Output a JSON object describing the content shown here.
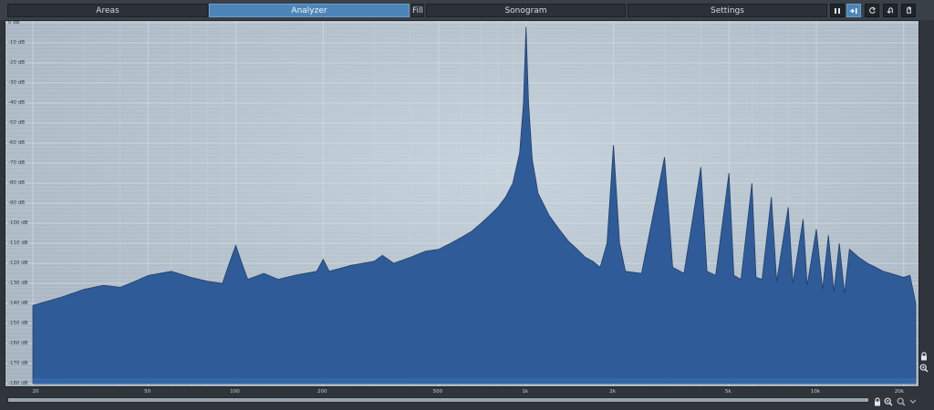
{
  "toolbar": {
    "tabs": [
      {
        "label": "Areas",
        "active": false
      },
      {
        "label": "Analyzer",
        "active": true
      },
      {
        "label": "Fill",
        "active": false
      },
      {
        "label": "Sonogram",
        "active": false
      },
      {
        "label": "Settings",
        "active": false
      }
    ],
    "buttons": [
      {
        "icon": "pause-icon",
        "active": false
      },
      {
        "icon": "freeze-icon",
        "active": true
      },
      {
        "icon": "reset-icon",
        "active": false
      },
      {
        "icon": "undo-icon",
        "active": false
      },
      {
        "icon": "redo-icon",
        "active": false
      }
    ]
  },
  "chart_data": {
    "type": "area",
    "x_scale": "log",
    "xlim": [
      20,
      22000
    ],
    "ylim": [
      -180,
      0
    ],
    "y_unit": "dB",
    "y_ticks": [
      "0 dB",
      "-10 dB",
      "-20 dB",
      "-30 dB",
      "-40 dB",
      "-50 dB",
      "-60 dB",
      "-70 dB",
      "-80 dB",
      "-90 dB",
      "-100 dB",
      "-110 dB",
      "-120 dB",
      "-130 dB",
      "-140 dB",
      "-150 dB",
      "-160 dB",
      "-170 dB",
      "-180 dB"
    ],
    "x_ticks": [
      {
        "freq": 20,
        "label": "20"
      },
      {
        "freq": 50,
        "label": "50"
      },
      {
        "freq": 100,
        "label": "100"
      },
      {
        "freq": 200,
        "label": "200"
      },
      {
        "freq": 500,
        "label": "500"
      },
      {
        "freq": 1000,
        "label": "1k"
      },
      {
        "freq": 2000,
        "label": "2k"
      },
      {
        "freq": 5000,
        "label": "5k"
      },
      {
        "freq": 10000,
        "label": "10k"
      },
      {
        "freq": 20000,
        "label": "20k"
      }
    ],
    "spectrum": [
      [
        20,
        -141
      ],
      [
        25,
        -137
      ],
      [
        30,
        -133
      ],
      [
        35,
        -131
      ],
      [
        40,
        -132
      ],
      [
        45,
        -129
      ],
      [
        50,
        -126
      ],
      [
        60,
        -124
      ],
      [
        70,
        -127
      ],
      [
        80,
        -129
      ],
      [
        90,
        -130
      ],
      [
        95,
        -120
      ],
      [
        100,
        -111
      ],
      [
        105,
        -120
      ],
      [
        110,
        -128
      ],
      [
        125,
        -125
      ],
      [
        140,
        -128
      ],
      [
        160,
        -126
      ],
      [
        190,
        -124
      ],
      [
        200,
        -118
      ],
      [
        210,
        -124
      ],
      [
        250,
        -121
      ],
      [
        300,
        -119
      ],
      [
        320,
        -116
      ],
      [
        350,
        -120
      ],
      [
        400,
        -117
      ],
      [
        450,
        -114
      ],
      [
        500,
        -113
      ],
      [
        550,
        -110
      ],
      [
        600,
        -107
      ],
      [
        650,
        -104
      ],
      [
        700,
        -100
      ],
      [
        750,
        -96
      ],
      [
        800,
        -92
      ],
      [
        850,
        -87
      ],
      [
        900,
        -80
      ],
      [
        950,
        -65
      ],
      [
        980,
        -40
      ],
      [
        1000,
        -2
      ],
      [
        1020,
        -40
      ],
      [
        1050,
        -68
      ],
      [
        1100,
        -85
      ],
      [
        1200,
        -96
      ],
      [
        1300,
        -103
      ],
      [
        1400,
        -109
      ],
      [
        1500,
        -113
      ],
      [
        1600,
        -117
      ],
      [
        1700,
        -119
      ],
      [
        1800,
        -122
      ],
      [
        1900,
        -110
      ],
      [
        2000,
        -61
      ],
      [
        2100,
        -110
      ],
      [
        2200,
        -124
      ],
      [
        2500,
        -125
      ],
      [
        3000,
        -67
      ],
      [
        3200,
        -122
      ],
      [
        3500,
        -125
      ],
      [
        4000,
        -72
      ],
      [
        4200,
        -124
      ],
      [
        4500,
        -126
      ],
      [
        5000,
        -75
      ],
      [
        5200,
        -126
      ],
      [
        5500,
        -128
      ],
      [
        6000,
        -80
      ],
      [
        6200,
        -127
      ],
      [
        6500,
        -128
      ],
      [
        7000,
        -87
      ],
      [
        7300,
        -129
      ],
      [
        8000,
        -92
      ],
      [
        8300,
        -130
      ],
      [
        9000,
        -98
      ],
      [
        9300,
        -131
      ],
      [
        10000,
        -103
      ],
      [
        10500,
        -133
      ],
      [
        11000,
        -106
      ],
      [
        11500,
        -134
      ],
      [
        12000,
        -110
      ],
      [
        12500,
        -135
      ],
      [
        13000,
        -113
      ],
      [
        14000,
        -117
      ],
      [
        15000,
        -120
      ],
      [
        16000,
        -122
      ],
      [
        17000,
        -124
      ],
      [
        18000,
        -125
      ],
      [
        19000,
        -126
      ],
      [
        20000,
        -127
      ],
      [
        21000,
        -126
      ],
      [
        22000,
        -140
      ]
    ],
    "fill_color": "#2f5c98",
    "grid": true
  },
  "axis_colors": {
    "grid": "#d9e2e8",
    "fill": "#2f5c98",
    "fill_edge": "#223f6a"
  }
}
